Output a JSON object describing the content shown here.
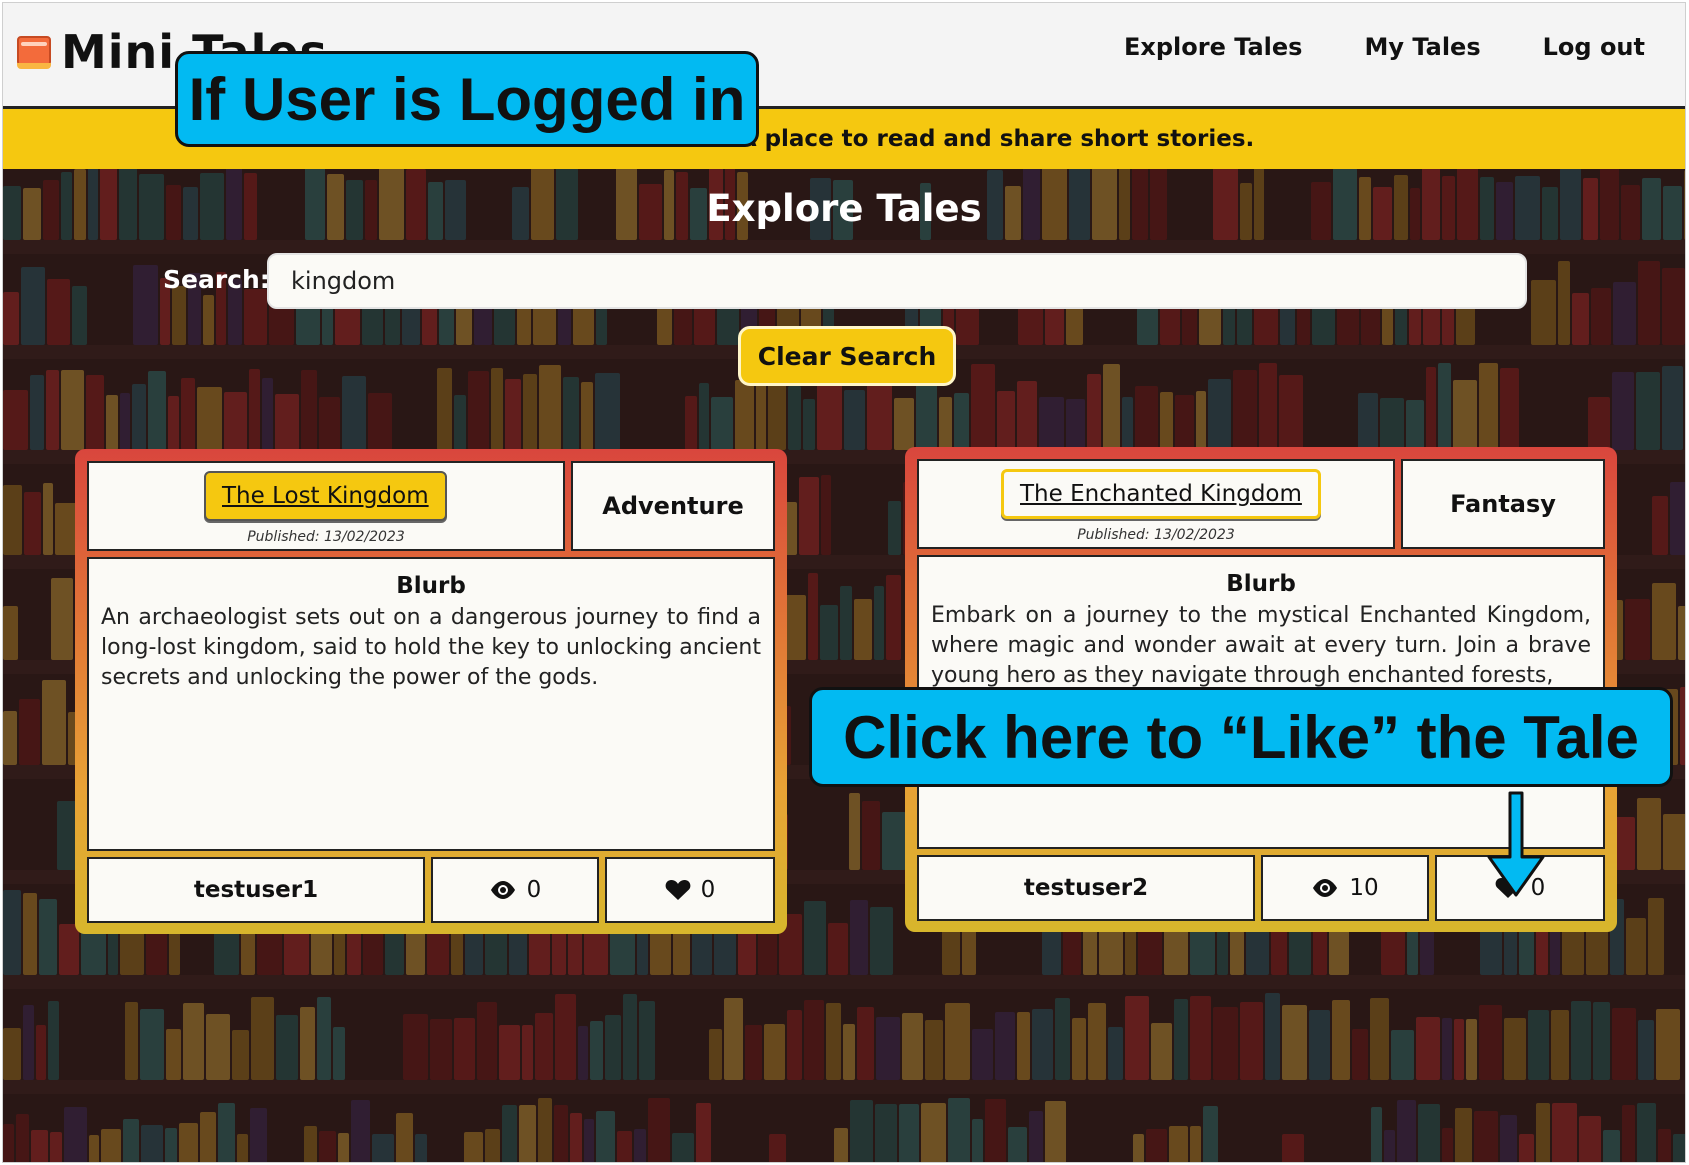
{
  "app": {
    "name": "Mini Tales"
  },
  "nav": {
    "links": [
      "Explore Tales",
      "My Tales",
      "Log out"
    ]
  },
  "welcome": {
    "text": "Welcome to Mini Tales. A place to read and share short stories."
  },
  "main": {
    "title": "Explore Tales",
    "search_label": "Search:",
    "search_value": "kingdom",
    "clear_label": "Clear Search"
  },
  "tales": [
    {
      "title": "The Lost Kingdom",
      "published": "Published: 13/02/2023",
      "genre": "Adventure",
      "blurb_heading": "Blurb",
      "blurb": "An archaeologist sets out on a dangerous journey to find a long-lost kingdom, said to hold the key to unlocking ancient secrets and unlocking the power of the gods.",
      "author": "testuser1",
      "views": "0",
      "likes": "0"
    },
    {
      "title": "The Enchanted Kingdom",
      "published": "Published: 13/02/2023",
      "genre": "Fantasy",
      "blurb_heading": "Blurb",
      "blurb": "Embark on a journey to the mystical Enchanted Kingdom, where magic and wonder await at every turn. Join a brave young hero as they navigate through enchanted forests,",
      "author": "testuser2",
      "views": "10",
      "likes": "0"
    }
  ],
  "annotations": {
    "top": "If User is Logged in",
    "like": "Click here to “Like” the Tale"
  },
  "colors": {
    "accent_yellow": "#f5c810",
    "callout_blue": "#02baf2",
    "card_gradient_top": "#d9463d",
    "card_gradient_bottom": "#d7b62c"
  },
  "icons": [
    "book-logo-icon",
    "eye-icon",
    "heart-icon",
    "arrow-down-icon"
  ]
}
